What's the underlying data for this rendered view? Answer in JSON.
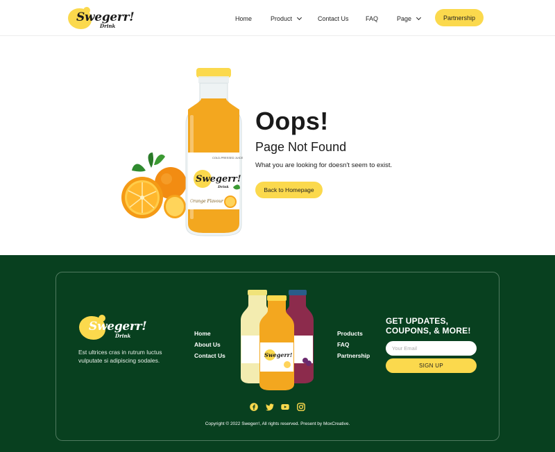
{
  "brand": {
    "name": "Swegerr!",
    "tagline": "Drink"
  },
  "header": {
    "nav": [
      {
        "label": "Home"
      },
      {
        "label": "Product",
        "has_dropdown": true
      },
      {
        "label": "Contact Us"
      },
      {
        "label": "FAQ"
      },
      {
        "label": "Page",
        "has_dropdown": true
      }
    ],
    "cta_label": "Partnership"
  },
  "error": {
    "headline": "Oops!",
    "title": "Page Not Found",
    "message": "What you are looking for doesn't seem to exist.",
    "button_label": "Back to Homepage",
    "bottle_label": {
      "cold_pressed": "COLD-PRESSED JUICE",
      "flavor": "Orange Flavour"
    }
  },
  "footer": {
    "description": "Est ultrices cras in rutrum luctus vulputate si adipiscing sodales.",
    "links_left": [
      "Home",
      "About Us",
      "Contact Us"
    ],
    "links_right": [
      "Products",
      "FAQ",
      "Partnership"
    ],
    "newsletter": {
      "title": "GET UPDATES, COUPONS, & MORE!",
      "email_placeholder": "Your Email",
      "button_label": "SIGN UP"
    },
    "social_icons": [
      "facebook-icon",
      "twitter-icon",
      "youtube-icon",
      "instagram-icon"
    ],
    "copyright": "Copyright © 2022 Swegerr!, All rights reserved. Present by MoxCreative."
  },
  "colors": {
    "accent_yellow": "#fbd94d",
    "footer_green": "#08401f",
    "juice_orange": "#f3a71f",
    "text_dark": "#1a1a1a"
  }
}
